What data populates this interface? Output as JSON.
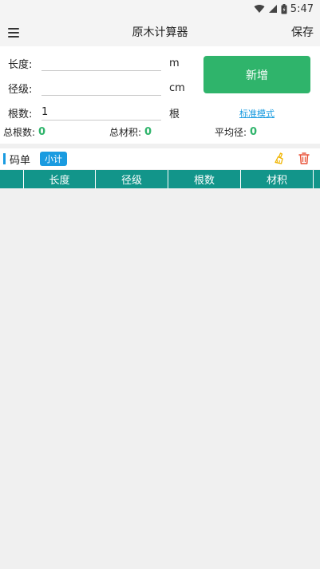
{
  "status": {
    "time": "5:47"
  },
  "header": {
    "title": "原木计算器",
    "save_label": "保存"
  },
  "form": {
    "length": {
      "label": "长度:",
      "value": "",
      "unit": "m"
    },
    "diameter": {
      "label": "径级:",
      "value": "",
      "unit": "cm"
    },
    "count": {
      "label": "根数:",
      "value": "1",
      "unit": "根"
    },
    "add_label": "新增",
    "mode_label": "标准模式"
  },
  "stats": {
    "total_count": {
      "label": "总根数:",
      "value": "0"
    },
    "total_volume": {
      "label": "总材积:",
      "value": "0"
    },
    "avg_diameter": {
      "label": "平均径:",
      "value": "0"
    }
  },
  "list": {
    "title": "码单",
    "subtotal_label": "小计",
    "columns": [
      "",
      "长度",
      "径级",
      "根数",
      "材积",
      ""
    ]
  },
  "colors": {
    "accent": "#2fb46b",
    "link": "#1a9be0",
    "table_header": "#12958a"
  }
}
